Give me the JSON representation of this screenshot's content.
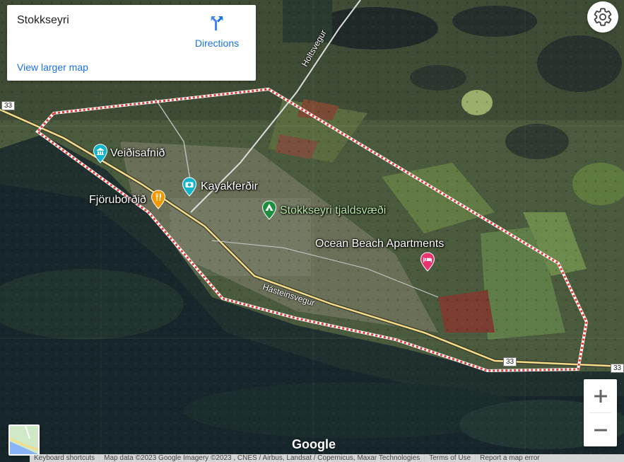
{
  "info_card": {
    "title": "Stokkseyri",
    "directions_label": "Directions",
    "view_larger_map": "View larger map"
  },
  "places": {
    "museum": "Veiðisafnið",
    "photo_spot": "Kayakferðir",
    "restaurant": "Fjöruborðið",
    "campground": "Stokkseyri tjaldsvæði",
    "lodging": "Ocean Beach Apartments"
  },
  "roads": {
    "north": "Holtsvegur",
    "main_street": "Hásteinsvegur",
    "route_number": "33"
  },
  "logo": "Google",
  "attribution": {
    "keyboard": "Keyboard shortcuts",
    "map_data": "Map data ©2023 Google Imagery ©2023 , CNES / Airbus, Landsat / Copernicus, Maxar Technologies",
    "terms": "Terms of Use",
    "report": "Report a map error"
  },
  "colors": {
    "link_blue": "#1a73e8",
    "boundary_red": "#e53935",
    "museum_pin": "#12b5cb",
    "food_pin": "#f29900",
    "camp_pin": "#1e8e3e",
    "lodging_pin": "#e8336e"
  },
  "icons": [
    "directions-icon",
    "settings-icon",
    "zoom-in-icon",
    "zoom-out-icon",
    "museum-icon",
    "camera-icon",
    "restaurant-icon",
    "campground-icon",
    "hotel-icon"
  ]
}
